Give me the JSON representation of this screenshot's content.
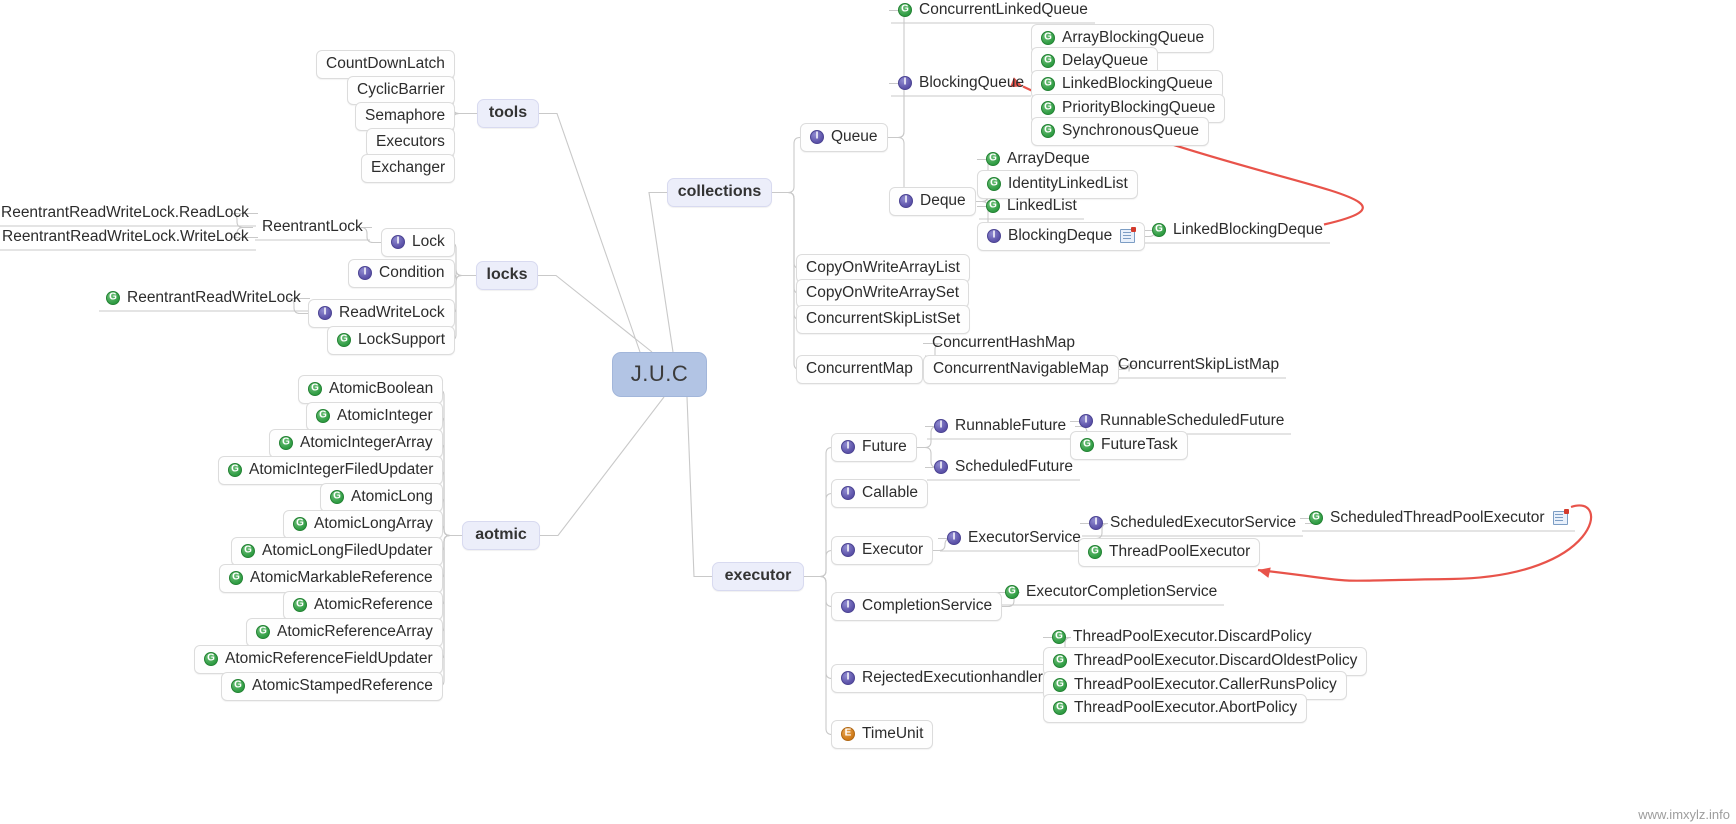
{
  "root": {
    "label": "J.U.C"
  },
  "watermark": "www.imxylz.info",
  "icons": {
    "class": "G",
    "interface": "I",
    "enum": "E"
  },
  "colors": {
    "root_bg": "#b2c4e4",
    "branch_bg": "#eceefa",
    "node_bg": "#fefefe",
    "class_icon": "#2f9c43",
    "interface_icon": "#5b51a8",
    "enum_icon": "#cf7a18",
    "arrow": "#e8534a",
    "link": "#c9c9c9"
  },
  "branches": [
    {
      "id": "tools",
      "label": "tools"
    },
    {
      "id": "locks",
      "label": "locks"
    },
    {
      "id": "aotmic",
      "label": "aotmic"
    },
    {
      "id": "collections",
      "label": "collections"
    },
    {
      "id": "executor",
      "label": "executor"
    }
  ],
  "tools": {
    "items": [
      {
        "label": "CountDownLatch",
        "icon": "none",
        "style": "boxed"
      },
      {
        "label": "CyclicBarrier",
        "icon": "none",
        "style": "boxed"
      },
      {
        "label": "Semaphore",
        "icon": "none",
        "style": "boxed"
      },
      {
        "label": "Executors",
        "icon": "none",
        "style": "boxed"
      },
      {
        "label": "Exchanger",
        "icon": "none",
        "style": "boxed"
      }
    ]
  },
  "locks": {
    "items": [
      {
        "label": "Lock",
        "icon": "interface",
        "style": "boxed"
      },
      {
        "label": "Condition",
        "icon": "interface",
        "style": "boxed"
      },
      {
        "label": "ReadWriteLock",
        "icon": "interface",
        "style": "boxed"
      },
      {
        "label": "LockSupport",
        "icon": "class",
        "style": "boxed"
      }
    ],
    "lock_children": [
      {
        "label": "ReentrantLock",
        "icon": "none",
        "style": "plain"
      }
    ],
    "reentrantlock_children": [
      {
        "label": "ReentrantReadWriteLock.ReadLock",
        "icon": "class",
        "style": "plain"
      },
      {
        "label": "ReentrantReadWriteLock.WriteLock",
        "icon": "class",
        "style": "plain"
      }
    ],
    "readwritelock_children": [
      {
        "label": "ReentrantReadWriteLock",
        "icon": "class",
        "style": "plain"
      }
    ]
  },
  "aotmic": {
    "items": [
      {
        "label": "AtomicBoolean",
        "icon": "class",
        "style": "boxed"
      },
      {
        "label": "AtomicInteger",
        "icon": "class",
        "style": "boxed"
      },
      {
        "label": "AtomicIntegerArray",
        "icon": "class",
        "style": "boxed"
      },
      {
        "label": "AtomicIntegerFiledUpdater",
        "icon": "class",
        "style": "boxed"
      },
      {
        "label": "AtomicLong",
        "icon": "class",
        "style": "boxed"
      },
      {
        "label": "AtomicLongArray",
        "icon": "class",
        "style": "boxed"
      },
      {
        "label": "AtomicLongFiledUpdater",
        "icon": "class",
        "style": "boxed"
      },
      {
        "label": "AtomicMarkableReference",
        "icon": "class",
        "style": "boxed"
      },
      {
        "label": "AtomicReference",
        "icon": "class",
        "style": "boxed"
      },
      {
        "label": "AtomicReferenceArray",
        "icon": "class",
        "style": "boxed"
      },
      {
        "label": "AtomicReferenceFieldUpdater",
        "icon": "class",
        "style": "boxed"
      },
      {
        "label": "AtomicStampedReference",
        "icon": "class",
        "style": "boxed"
      }
    ]
  },
  "collections": {
    "items": [
      {
        "label": "Queue",
        "icon": "interface",
        "style": "boxed"
      },
      {
        "label": "CopyOnWriteArrayList",
        "icon": "none",
        "style": "boxed"
      },
      {
        "label": "CopyOnWriteArraySet",
        "icon": "none",
        "style": "boxed"
      },
      {
        "label": "ConcurrentSkipListSet",
        "icon": "none",
        "style": "boxed"
      },
      {
        "label": "ConcurrentMap",
        "icon": "none",
        "style": "boxed"
      }
    ],
    "queue_children": [
      {
        "label": "ConcurrentLinkedQueue",
        "icon": "class",
        "style": "plain"
      },
      {
        "label": "BlockingQueue",
        "icon": "interface",
        "style": "plain"
      },
      {
        "label": "Deque",
        "icon": "interface",
        "style": "boxed"
      }
    ],
    "blockingqueue_children": [
      {
        "label": "ArrayBlockingQueue",
        "icon": "class",
        "style": "boxed"
      },
      {
        "label": "DelayQueue",
        "icon": "class",
        "style": "boxed"
      },
      {
        "label": "LinkedBlockingQueue",
        "icon": "class",
        "style": "boxed"
      },
      {
        "label": "PriorityBlockingQueue",
        "icon": "class",
        "style": "boxed"
      },
      {
        "label": "SynchronousQueue",
        "icon": "class",
        "style": "boxed"
      }
    ],
    "deque_children": [
      {
        "label": "ArrayDeque",
        "icon": "class",
        "style": "plain"
      },
      {
        "label": "IdentityLinkedList",
        "icon": "class",
        "style": "boxed"
      },
      {
        "label": "LinkedList",
        "icon": "class",
        "style": "plain"
      },
      {
        "label": "BlockingDeque",
        "icon": "interface",
        "style": "boxed",
        "note": true
      }
    ],
    "blockingdeque_children": [
      {
        "label": "LinkedBlockingDeque",
        "icon": "class",
        "style": "plain"
      }
    ],
    "concurrentmap_children": [
      {
        "label": "ConcurrentHashMap",
        "icon": "none",
        "style": "plain"
      },
      {
        "label": "ConcurrentNavigableMap",
        "icon": "none",
        "style": "boxed"
      }
    ],
    "concurrentnavigablemap_children": [
      {
        "label": "ConcurrentSkipListMap",
        "icon": "none",
        "style": "plain"
      }
    ]
  },
  "executor": {
    "items": [
      {
        "label": "Future",
        "icon": "interface",
        "style": "boxed"
      },
      {
        "label": "Callable",
        "icon": "interface",
        "style": "boxed"
      },
      {
        "label": "Executor",
        "icon": "interface",
        "style": "boxed"
      },
      {
        "label": "CompletionService",
        "icon": "interface",
        "style": "boxed"
      },
      {
        "label": "RejectedExecutionhandler",
        "icon": "interface",
        "style": "boxed"
      },
      {
        "label": "TimeUnit",
        "icon": "enum",
        "style": "boxed"
      }
    ],
    "future_children": [
      {
        "label": "RunnableFuture",
        "icon": "interface",
        "style": "plain"
      },
      {
        "label": "ScheduledFuture",
        "icon": "interface",
        "style": "plain"
      }
    ],
    "runnablefuture_children": [
      {
        "label": "RunnableScheduledFuture",
        "icon": "interface",
        "style": "plain"
      },
      {
        "label": "FutureTask",
        "icon": "class",
        "style": "boxed"
      }
    ],
    "executor_children": [
      {
        "label": "ExecutorService",
        "icon": "interface",
        "style": "plain"
      }
    ],
    "executorservice_children": [
      {
        "label": "ScheduledExecutorService",
        "icon": "interface",
        "style": "plain"
      },
      {
        "label": "ThreadPoolExecutor",
        "icon": "class",
        "style": "boxed"
      }
    ],
    "scheduledexecutorservice_children": [
      {
        "label": "ScheduledThreadPoolExecutor",
        "icon": "class",
        "style": "plain",
        "note": true
      }
    ],
    "completionservice_children": [
      {
        "label": "ExecutorCompletionService",
        "icon": "class",
        "style": "plain"
      }
    ],
    "rejected_children": [
      {
        "label": "ThreadPoolExecutor.DiscardPolicy",
        "icon": "class",
        "style": "plain"
      },
      {
        "label": "ThreadPoolExecutor.DiscardOldestPolicy",
        "icon": "class",
        "style": "boxed"
      },
      {
        "label": "ThreadPoolExecutor.CallerRunsPolicy",
        "icon": "class",
        "style": "boxed"
      },
      {
        "label": "ThreadPoolExecutor.AbortPolicy",
        "icon": "class",
        "style": "boxed"
      }
    ]
  },
  "annotations": [
    {
      "id": "arrow-to-blockingqueue",
      "from": "LinkedBlockingDeque",
      "to": "BlockingQueue"
    },
    {
      "id": "arrow-to-threadpoolexecutor",
      "from": "ScheduledThreadPoolExecutor",
      "to": "ThreadPoolExecutor"
    }
  ]
}
